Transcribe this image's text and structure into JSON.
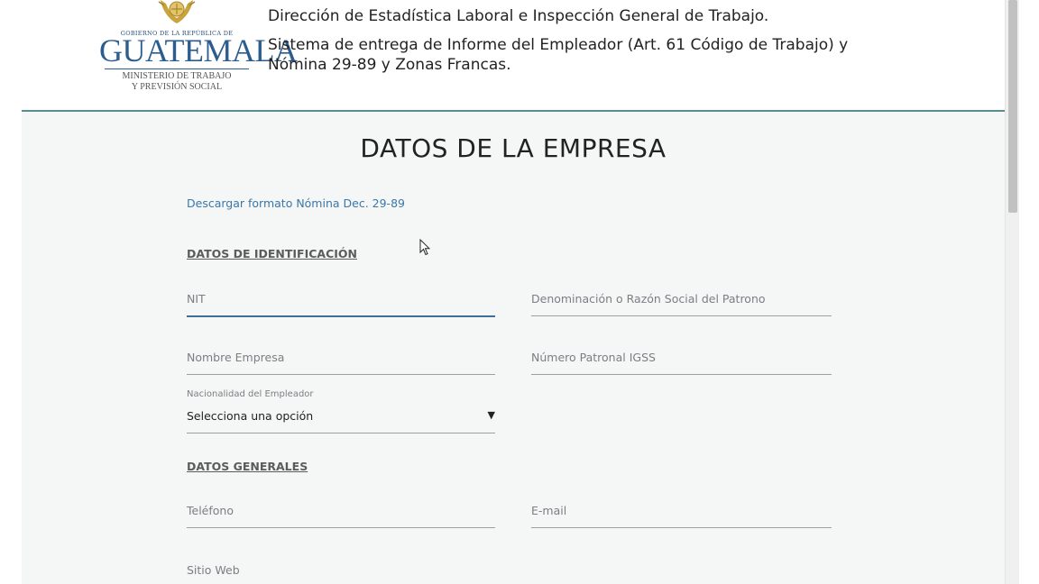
{
  "header": {
    "logo": {
      "gobierno": "GOBIERNO DE LA REPÚBLICA DE",
      "country": "GUATEMALA",
      "ministry_line1": "MINISTERIO DE TRABAJO",
      "ministry_line2": "Y PREVISIÓN SOCIAL"
    },
    "line1": "Dirección de Estadística Laboral e Inspección General de Trabajo.",
    "line2": "Sistema de entrega de Informe del Empleador (Art. 61 Código de Trabajo) y",
    "line3": "Nómina 29-89 y Zonas Francas."
  },
  "main": {
    "title": "DATOS DE LA EMPRESA",
    "download_link": "Descargar formato Nómina Dec. 29-89",
    "identification": {
      "heading": "DATOS DE IDENTIFICACIÓN",
      "nit_placeholder": "NIT",
      "razon_social_placeholder": "Denominación o Razón Social del Patrono",
      "nombre_empresa_placeholder": "Nombre Empresa",
      "numero_patronal_placeholder": "Número Patronal IGSS",
      "nacionalidad_label": "Nacionalidad del Empleador",
      "nacionalidad_selected": "Selecciona una opción"
    },
    "general": {
      "heading": "DATOS GENERALES",
      "telefono_placeholder": "Teléfono",
      "email_placeholder": "E-mail",
      "sitio_web_placeholder": "Sitio Web"
    }
  },
  "colors": {
    "link": "#3a78a8",
    "active_underline": "#3f6f99",
    "header_border": "#5a8b8f",
    "logo_blue": "#2c5d8f",
    "emblem_gold": "#c9a43b"
  },
  "icons": {
    "emblem": "coat-of-arms-icon",
    "select_caret": "caret-down-icon",
    "pointer": "mouse-pointer-icon"
  }
}
